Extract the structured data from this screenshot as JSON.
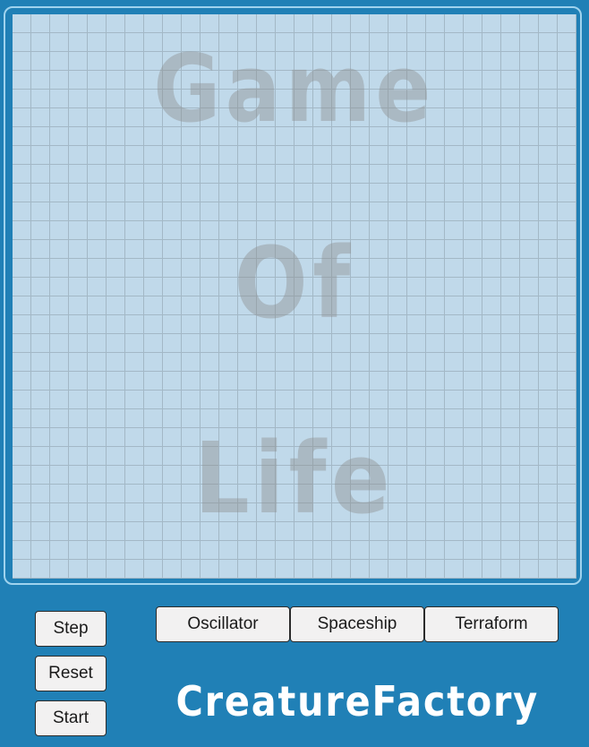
{
  "board": {
    "title_lines": [
      "Game",
      "Of",
      "Life"
    ]
  },
  "controls": {
    "step_label": "Step",
    "reset_label": "Reset",
    "start_label": "Start"
  },
  "creatures": {
    "oscillator_label": "Oscillator",
    "spaceship_label": "Spaceship",
    "terraform_label": "Terraform"
  },
  "factory": {
    "title": "CreatureFactory"
  }
}
